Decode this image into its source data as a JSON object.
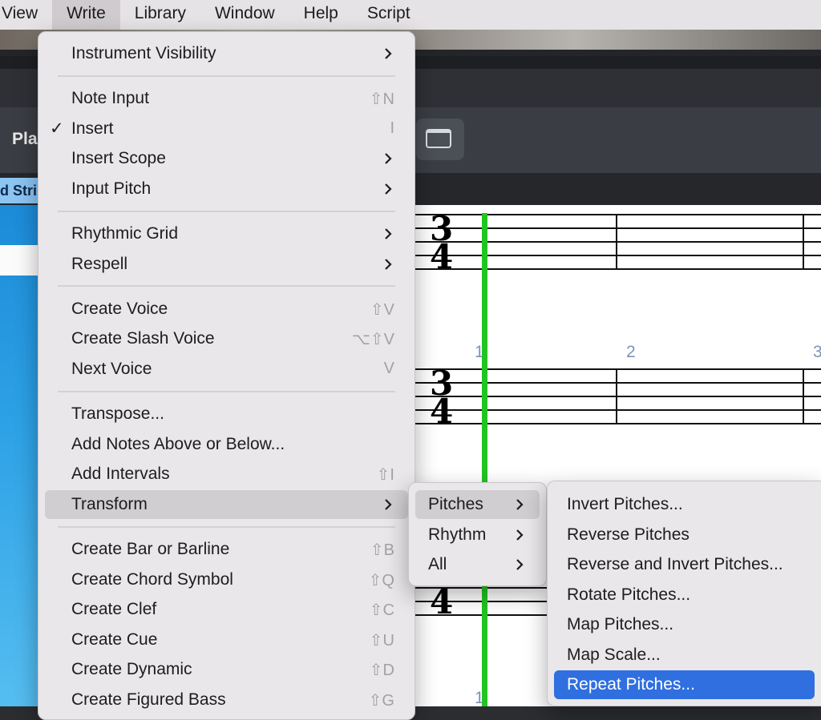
{
  "menubar": {
    "items": [
      "View",
      "Write",
      "Library",
      "Window",
      "Help",
      "Script"
    ]
  },
  "app": {
    "tab_partial": "Pla",
    "strip_label": "d Stri"
  },
  "score": {
    "time_signature": {
      "num": "3",
      "den": "4"
    },
    "bar_numbers": [
      "1",
      "2",
      "3",
      "1"
    ],
    "playhead_color": "#22c422"
  },
  "write_menu": {
    "items": [
      {
        "label": "Instrument Visibility",
        "submenu": true
      },
      {
        "label": "Note Input",
        "shortcut": "⇧N"
      },
      {
        "label": "Insert",
        "shortcut": "I",
        "checked": "✓"
      },
      {
        "label": "Insert Scope",
        "submenu": true
      },
      {
        "label": "Input Pitch",
        "submenu": true
      },
      {
        "label": "Rhythmic Grid",
        "submenu": true
      },
      {
        "label": "Respell",
        "submenu": true
      },
      {
        "label": "Create Voice",
        "shortcut": "⇧V"
      },
      {
        "label": "Create Slash Voice",
        "shortcut": "⌥⇧V"
      },
      {
        "label": "Next Voice",
        "shortcut": "V"
      },
      {
        "label": "Transpose..."
      },
      {
        "label": "Add Notes Above or Below..."
      },
      {
        "label": "Add Intervals",
        "shortcut": "⇧I"
      },
      {
        "label": "Transform",
        "submenu": true
      },
      {
        "label": "Create Bar or Barline",
        "shortcut": "⇧B"
      },
      {
        "label": "Create Chord Symbol",
        "shortcut": "⇧Q"
      },
      {
        "label": "Create Clef",
        "shortcut": "⇧C"
      },
      {
        "label": "Create Cue",
        "shortcut": "⇧U"
      },
      {
        "label": "Create Dynamic",
        "shortcut": "⇧D"
      },
      {
        "label": "Create Figured Bass",
        "shortcut": "⇧G"
      }
    ]
  },
  "transform_menu": {
    "items": [
      {
        "label": "Pitches"
      },
      {
        "label": "Rhythm"
      },
      {
        "label": "All"
      }
    ]
  },
  "pitches_menu": {
    "items": [
      {
        "label": "Invert Pitches..."
      },
      {
        "label": "Reverse Pitches"
      },
      {
        "label": "Reverse and Invert Pitches..."
      },
      {
        "label": "Rotate Pitches..."
      },
      {
        "label": "Map Pitches..."
      },
      {
        "label": "Map Scale..."
      },
      {
        "label": "Repeat Pitches..."
      }
    ]
  },
  "colors": {
    "highlight_blue": "#2f6fe0",
    "highlight_gray": "#d0ced0",
    "menu_bg": "#e9e7e9"
  }
}
